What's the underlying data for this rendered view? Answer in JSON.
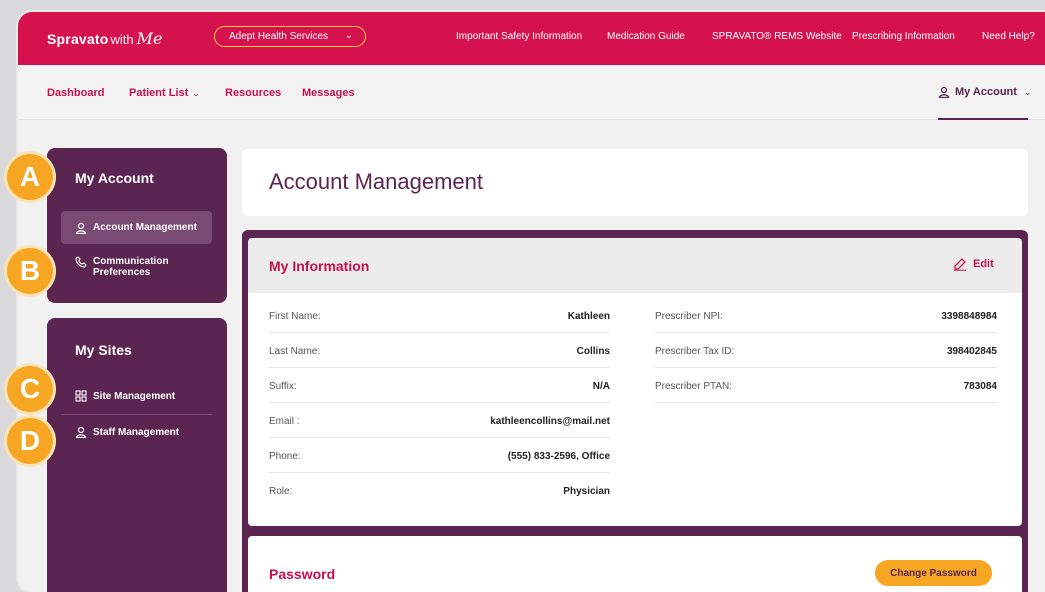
{
  "topbar": {
    "brand": "Spravato",
    "with": "with",
    "me": "Me",
    "org_select": "Adept Health Services",
    "links": [
      "Important Safety Information",
      "Medication Guide",
      "SPRAVATO® REMS Website",
      "Prescribing Information",
      "Need Help?"
    ]
  },
  "nav": {
    "items": [
      "Dashboard",
      "Patient List",
      "Resources",
      "Messages"
    ],
    "account": "My Account"
  },
  "sidebar": {
    "account_title": "My Account",
    "account_items": [
      "Account Management",
      "Communication",
      "Preferences"
    ],
    "sites_title": "My Sites",
    "sites_items": [
      "Site Management",
      "Staff Management"
    ]
  },
  "badges": [
    "A",
    "B",
    "C",
    "D"
  ],
  "main": {
    "page_title": "Account Management",
    "info_title": "My Information",
    "edit_label": "Edit",
    "left_fields": [
      {
        "label": "First Name:",
        "value": "Kathleen"
      },
      {
        "label": "Last Name:",
        "value": "Collins"
      },
      {
        "label": "Suffix:",
        "value": "N/A"
      },
      {
        "label": "Email :",
        "value": "kathleencollins@mail.net"
      },
      {
        "label": "Phone:",
        "value": "(555) 833-2596, Office"
      },
      {
        "label": "Role:",
        "value": "Physician"
      }
    ],
    "right_fields": [
      {
        "label": "Prescriber NPI:",
        "value": "3398848984"
      },
      {
        "label": "Prescriber Tax ID:",
        "value": "398402845"
      },
      {
        "label": "Prescriber PTAN:",
        "value": "783084"
      }
    ],
    "password_title": "Password",
    "change_password_label": "Change Password"
  },
  "colors": {
    "brand_red": "#d5124e",
    "plum": "#5b2552",
    "accent_orange": "#f6a623"
  }
}
